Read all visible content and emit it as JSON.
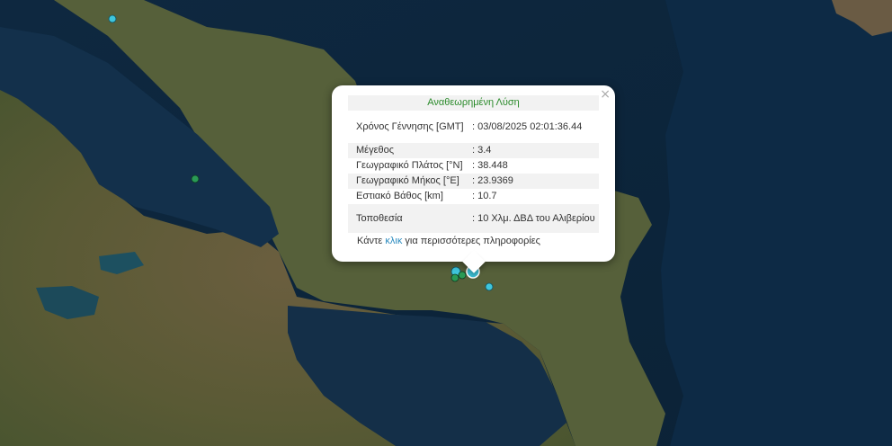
{
  "popup": {
    "title": "Αναθεωρημένη Λύση",
    "close_glyph": "×",
    "rows": [
      {
        "label": "Χρόνος Γέννησης [GMT]",
        "value": ": 03/08/2025 02:01:36.44"
      },
      {
        "label": "Μέγεθος",
        "value": ": 3.4"
      },
      {
        "label": "Γεωγραφικό Πλάτος [°N]",
        "value": ": 38.448"
      },
      {
        "label": "Γεωγραφικό Μήκος [°E]",
        "value": ": 23.9369"
      },
      {
        "label": "Εστιακό Βάθος [km]",
        "value": ": 10.7"
      },
      {
        "label": "Τοποθεσία",
        "value": ": 10 Χλμ. ΔΒΔ του Αλιβερίου"
      }
    ],
    "more_prefix": "Κάντε ",
    "more_link": "κλικ",
    "more_suffix": " για περισσότερες πληροφορίες"
  },
  "colors": {
    "sea": "#0f2a44",
    "marker_cyan": "#3fc6dc",
    "marker_green": "#2a9a55",
    "title_green": "#2a8a2a",
    "link_blue": "#2b8bbf"
  }
}
